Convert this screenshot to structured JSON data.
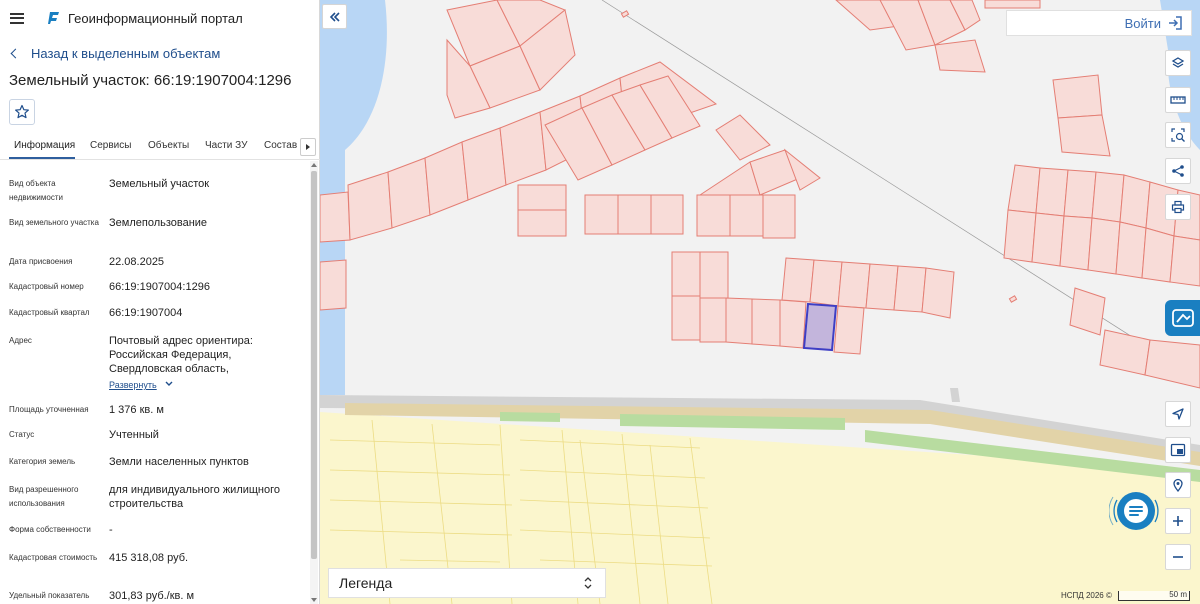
{
  "header": {
    "app_title": "Геоинформационный портал"
  },
  "back_link": "Назад к выделенным объектам",
  "page_title": "Земельный участок: 66:19:1907004:1296",
  "tabs": [
    "Информация",
    "Сервисы",
    "Объекты",
    "Части ЗУ",
    "Состав"
  ],
  "fields": [
    {
      "label": "Вид объекта недвижимости",
      "value": "Земельный участок"
    },
    {
      "label": "Вид земельного участка",
      "value": "Землепользование"
    },
    {
      "label": "Дата присвоения",
      "value": "22.08.2025"
    },
    {
      "label": "Кадастровый номер",
      "value": "66:19:1907004:1296"
    },
    {
      "label": "Кадастровый квартал",
      "value": "66:19:1907004"
    },
    {
      "label": "Адрес",
      "value": "Почтовый адрес ориентира: Российская Федерация, Свердловская область,",
      "expand": "Развернуть"
    },
    {
      "label": "Площадь уточненная",
      "value": "1 376 кв. м"
    },
    {
      "label": "Статус",
      "value": "Учтенный"
    },
    {
      "label": "Категория земель",
      "value": "Земли населенных пунктов"
    },
    {
      "label": "Вид разрешенного использования",
      "value": "для индивидуального жилищного строительства"
    },
    {
      "label": "Форма собственности",
      "value": "-"
    },
    {
      "label": "Кадастровая стоимость",
      "value": "415 318,08 руб."
    },
    {
      "label": "Удельный показатель",
      "value": "301,83 руб./кв. м"
    }
  ],
  "map": {
    "login_label": "Войти",
    "legend_label": "Легенда",
    "attribution": "НСПД 2026 ©",
    "scale_label": "50 m",
    "colors": {
      "parcel_fill": "#f8dcd8",
      "parcel_stroke": "#e47e74",
      "selected_fill": "#c3b5dc",
      "selected_stroke": "#3e3ec4",
      "water": "#b8d6f5",
      "agri": "#fbf6cd",
      "road": "#d3d3d3",
      "green": "#b8dca0",
      "accent": "#1a7fc1"
    }
  }
}
